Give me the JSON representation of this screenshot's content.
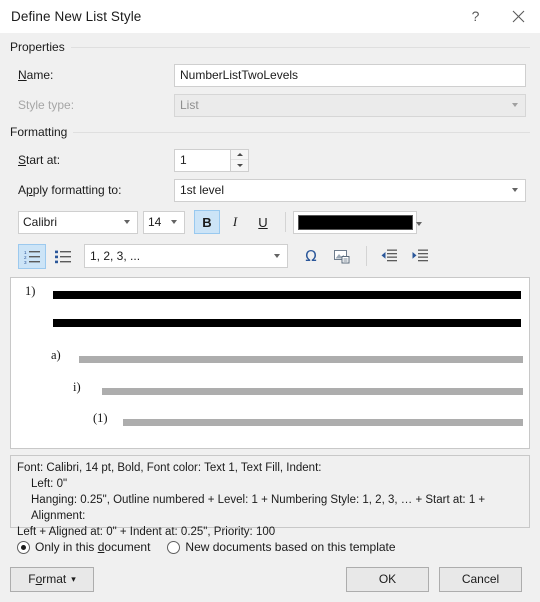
{
  "titlebar": {
    "title": "Define New List Style",
    "help_icon": "question-mark-icon",
    "close_icon": "close-icon"
  },
  "groups": {
    "properties": "Properties",
    "formatting": "Formatting"
  },
  "properties": {
    "name_label": "Name:",
    "name_accel": "N",
    "name_value": "NumberListTwoLevels",
    "style_type_label": "Style type:",
    "style_type_value": "List",
    "style_type_disabled": true
  },
  "formatting": {
    "start_at_label": "Start at:",
    "start_at_accel": "S",
    "start_at_value": "1",
    "apply_to_label": "Apply formatting to:",
    "apply_to_value": "1st level"
  },
  "font_toolbar": {
    "font_family": "Calibri",
    "font_size": "14",
    "bold_label": "B",
    "bold_active": true,
    "italic_label": "I",
    "italic_active": false,
    "underline_label": "U",
    "underline_active": false,
    "font_color": "#000000"
  },
  "list_toolbar": {
    "numbered_list_icon": "numbered-list-icon",
    "numbered_list_active": true,
    "bulleted_list_icon": "bulleted-list-icon",
    "number_format_value": "1, 2, 3, ...",
    "symbol_icon": "omega-symbol-icon",
    "symbol_glyph": "Ω",
    "picture_icon": "insert-picture-icon",
    "decrease_indent_icon": "decrease-indent-icon",
    "increase_indent_icon": "increase-indent-icon"
  },
  "preview": {
    "lines": [
      {
        "marker": "1)",
        "level": 1,
        "bar": "black"
      },
      {
        "marker": "",
        "level": 1,
        "bar": "black"
      },
      {
        "marker": "a)",
        "level": 2,
        "bar": "gray"
      },
      {
        "marker": "i)",
        "level": 3,
        "bar": "gray"
      },
      {
        "marker": "(1)",
        "level": 4,
        "bar": "gray"
      }
    ]
  },
  "description": {
    "line1": "Font: Calibri, 14 pt, Bold, Font color: Text 1, Text Fill, Indent:",
    "line2": "Left:  0\"",
    "line3": "Hanging:  0.25\", Outline numbered + Level: 1 + Numbering Style: 1, 2, 3, … + Start at: 1 + Alignment:",
    "line4": "Left + Aligned at:  0\" + Indent at:  0.25\", Priority: 100"
  },
  "scope": {
    "option1": "Only in this document",
    "option1_selected": true,
    "option2": "New documents based on this template",
    "option2_selected": false
  },
  "footer": {
    "format_label": "Format",
    "format_caret": "▾",
    "ok_label": "OK",
    "cancel_label": "Cancel"
  }
}
